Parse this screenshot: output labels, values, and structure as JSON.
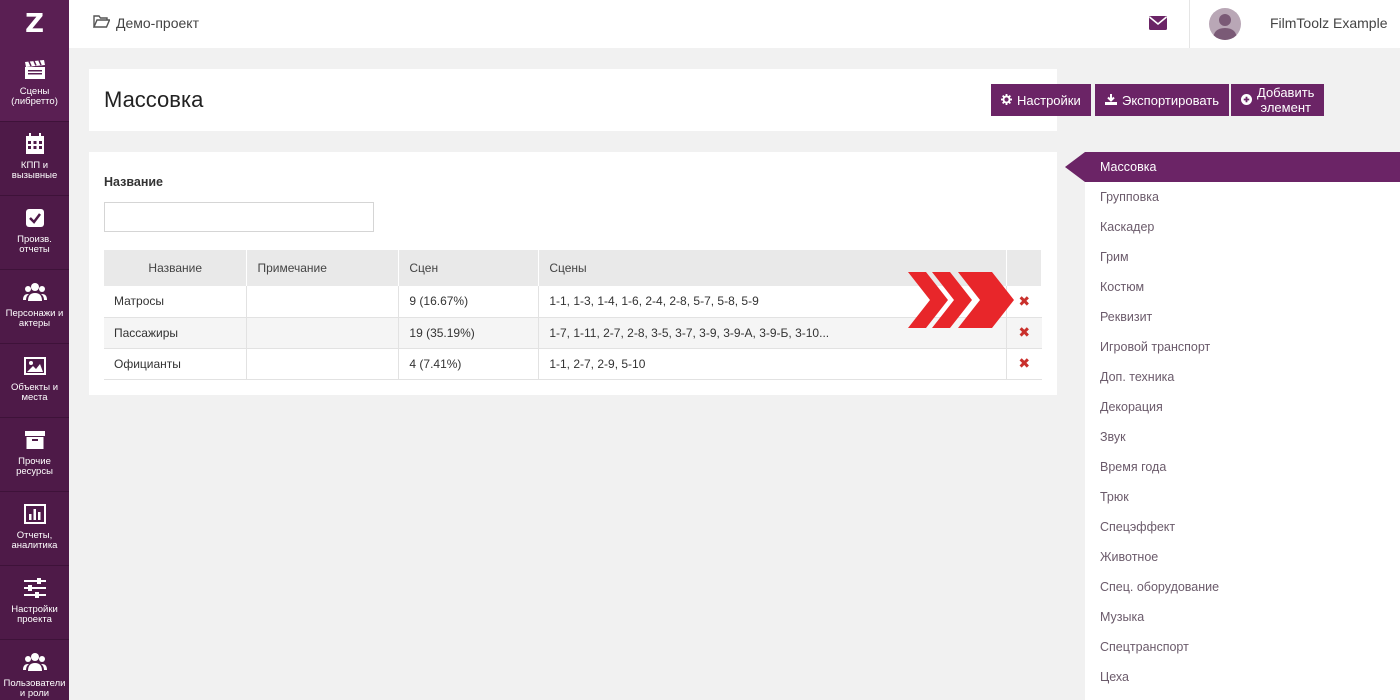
{
  "app": {
    "logo": "Z",
    "project": "Демо-проект",
    "user_name": "FilmToolz Example"
  },
  "sidebar": {
    "items": [
      {
        "label": "Сцены (либретто)",
        "icon": "clapperboard-icon"
      },
      {
        "label": "КПП и вызывные",
        "icon": "calendar-icon"
      },
      {
        "label": "Произв. отчеты",
        "icon": "checkbox-icon"
      },
      {
        "label": "Персонажи и актеры",
        "icon": "users-icon"
      },
      {
        "label": "Объекты и места",
        "icon": "image-icon"
      },
      {
        "label": "Прочие ресурсы",
        "icon": "archive-box-icon"
      },
      {
        "label": "Отчеты, аналитика",
        "icon": "bar-chart-icon"
      },
      {
        "label": "Настройки проекта",
        "icon": "sliders-icon"
      },
      {
        "label": "Пользователи и роли",
        "icon": "users-icon"
      }
    ]
  },
  "header": {
    "title": "Массовка",
    "buttons": {
      "settings": "Настройки",
      "export": "Экспортировать",
      "add": "Добавить элемент"
    }
  },
  "filter": {
    "label": "Название",
    "value": "",
    "placeholder": ""
  },
  "table": {
    "columns": [
      "Название",
      "Примечание",
      "Сцен",
      "Сцены"
    ],
    "rows": [
      {
        "name": "Матросы",
        "note": "",
        "count": "9 (16.67%)",
        "scenes": "1-1, 1-3, 1-4, 1-6, 2-4, 2-8, 5-7, 5-8, 5-9"
      },
      {
        "name": "Пассажиры",
        "note": "",
        "count": "19 (35.19%)",
        "scenes": "1-7, 1-11, 2-7, 2-8, 3-5, 3-7, 3-9, 3-9-А, 3-9-Б, 3-10..."
      },
      {
        "name": "Официанты",
        "note": "",
        "count": "4 (7.41%)",
        "scenes": "1-1, 2-7, 2-9, 5-10"
      }
    ],
    "delete_glyph": "✖"
  },
  "categories": {
    "active": "Массовка",
    "items": [
      "Массовка",
      "Групповка",
      "Каскадер",
      "Грим",
      "Костюм",
      "Реквизит",
      "Игровой транспорт",
      "Доп. техника",
      "Декорация",
      "Звук",
      "Время года",
      "Трюк",
      "Спецэффект",
      "Животное",
      "Спец. оборудование",
      "Музыка",
      "Спецтранспорт",
      "Цеха"
    ]
  },
  "colors": {
    "sidebar": "#4e1a48",
    "accent": "#6b2466",
    "delete": "#c9302c",
    "arrow": "#e8262a"
  }
}
